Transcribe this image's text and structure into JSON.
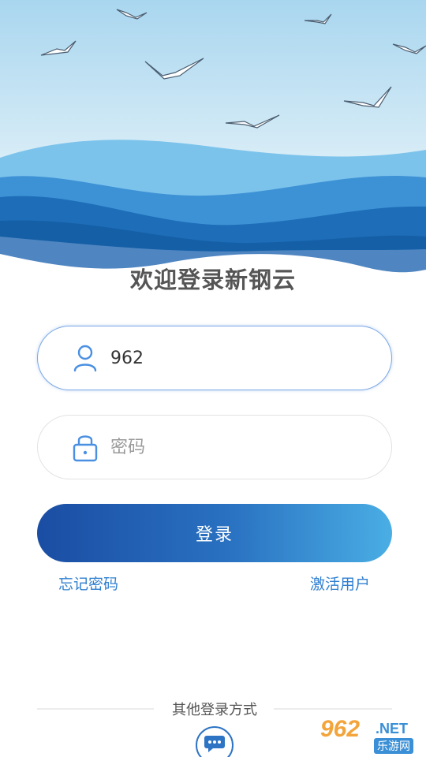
{
  "header": {
    "title": "欢迎登录新钢云"
  },
  "form": {
    "username_value": "962",
    "username_icon": "user-icon",
    "password_placeholder": "密码",
    "password_icon": "lock-icon",
    "login_label": "登录",
    "forgot_label": "忘记密码",
    "activate_label": "激活用户"
  },
  "other_login": {
    "label": "其他登录方式",
    "option_icon": "chat-bubble-icon"
  },
  "watermark": {
    "number": "962",
    "suffix": ".NET",
    "site": "乐游网"
  },
  "colors": {
    "accent": "#2f7fd0",
    "button_start": "#1a4da3",
    "button_end": "#4aaee4",
    "sky": "#cde6f4"
  }
}
